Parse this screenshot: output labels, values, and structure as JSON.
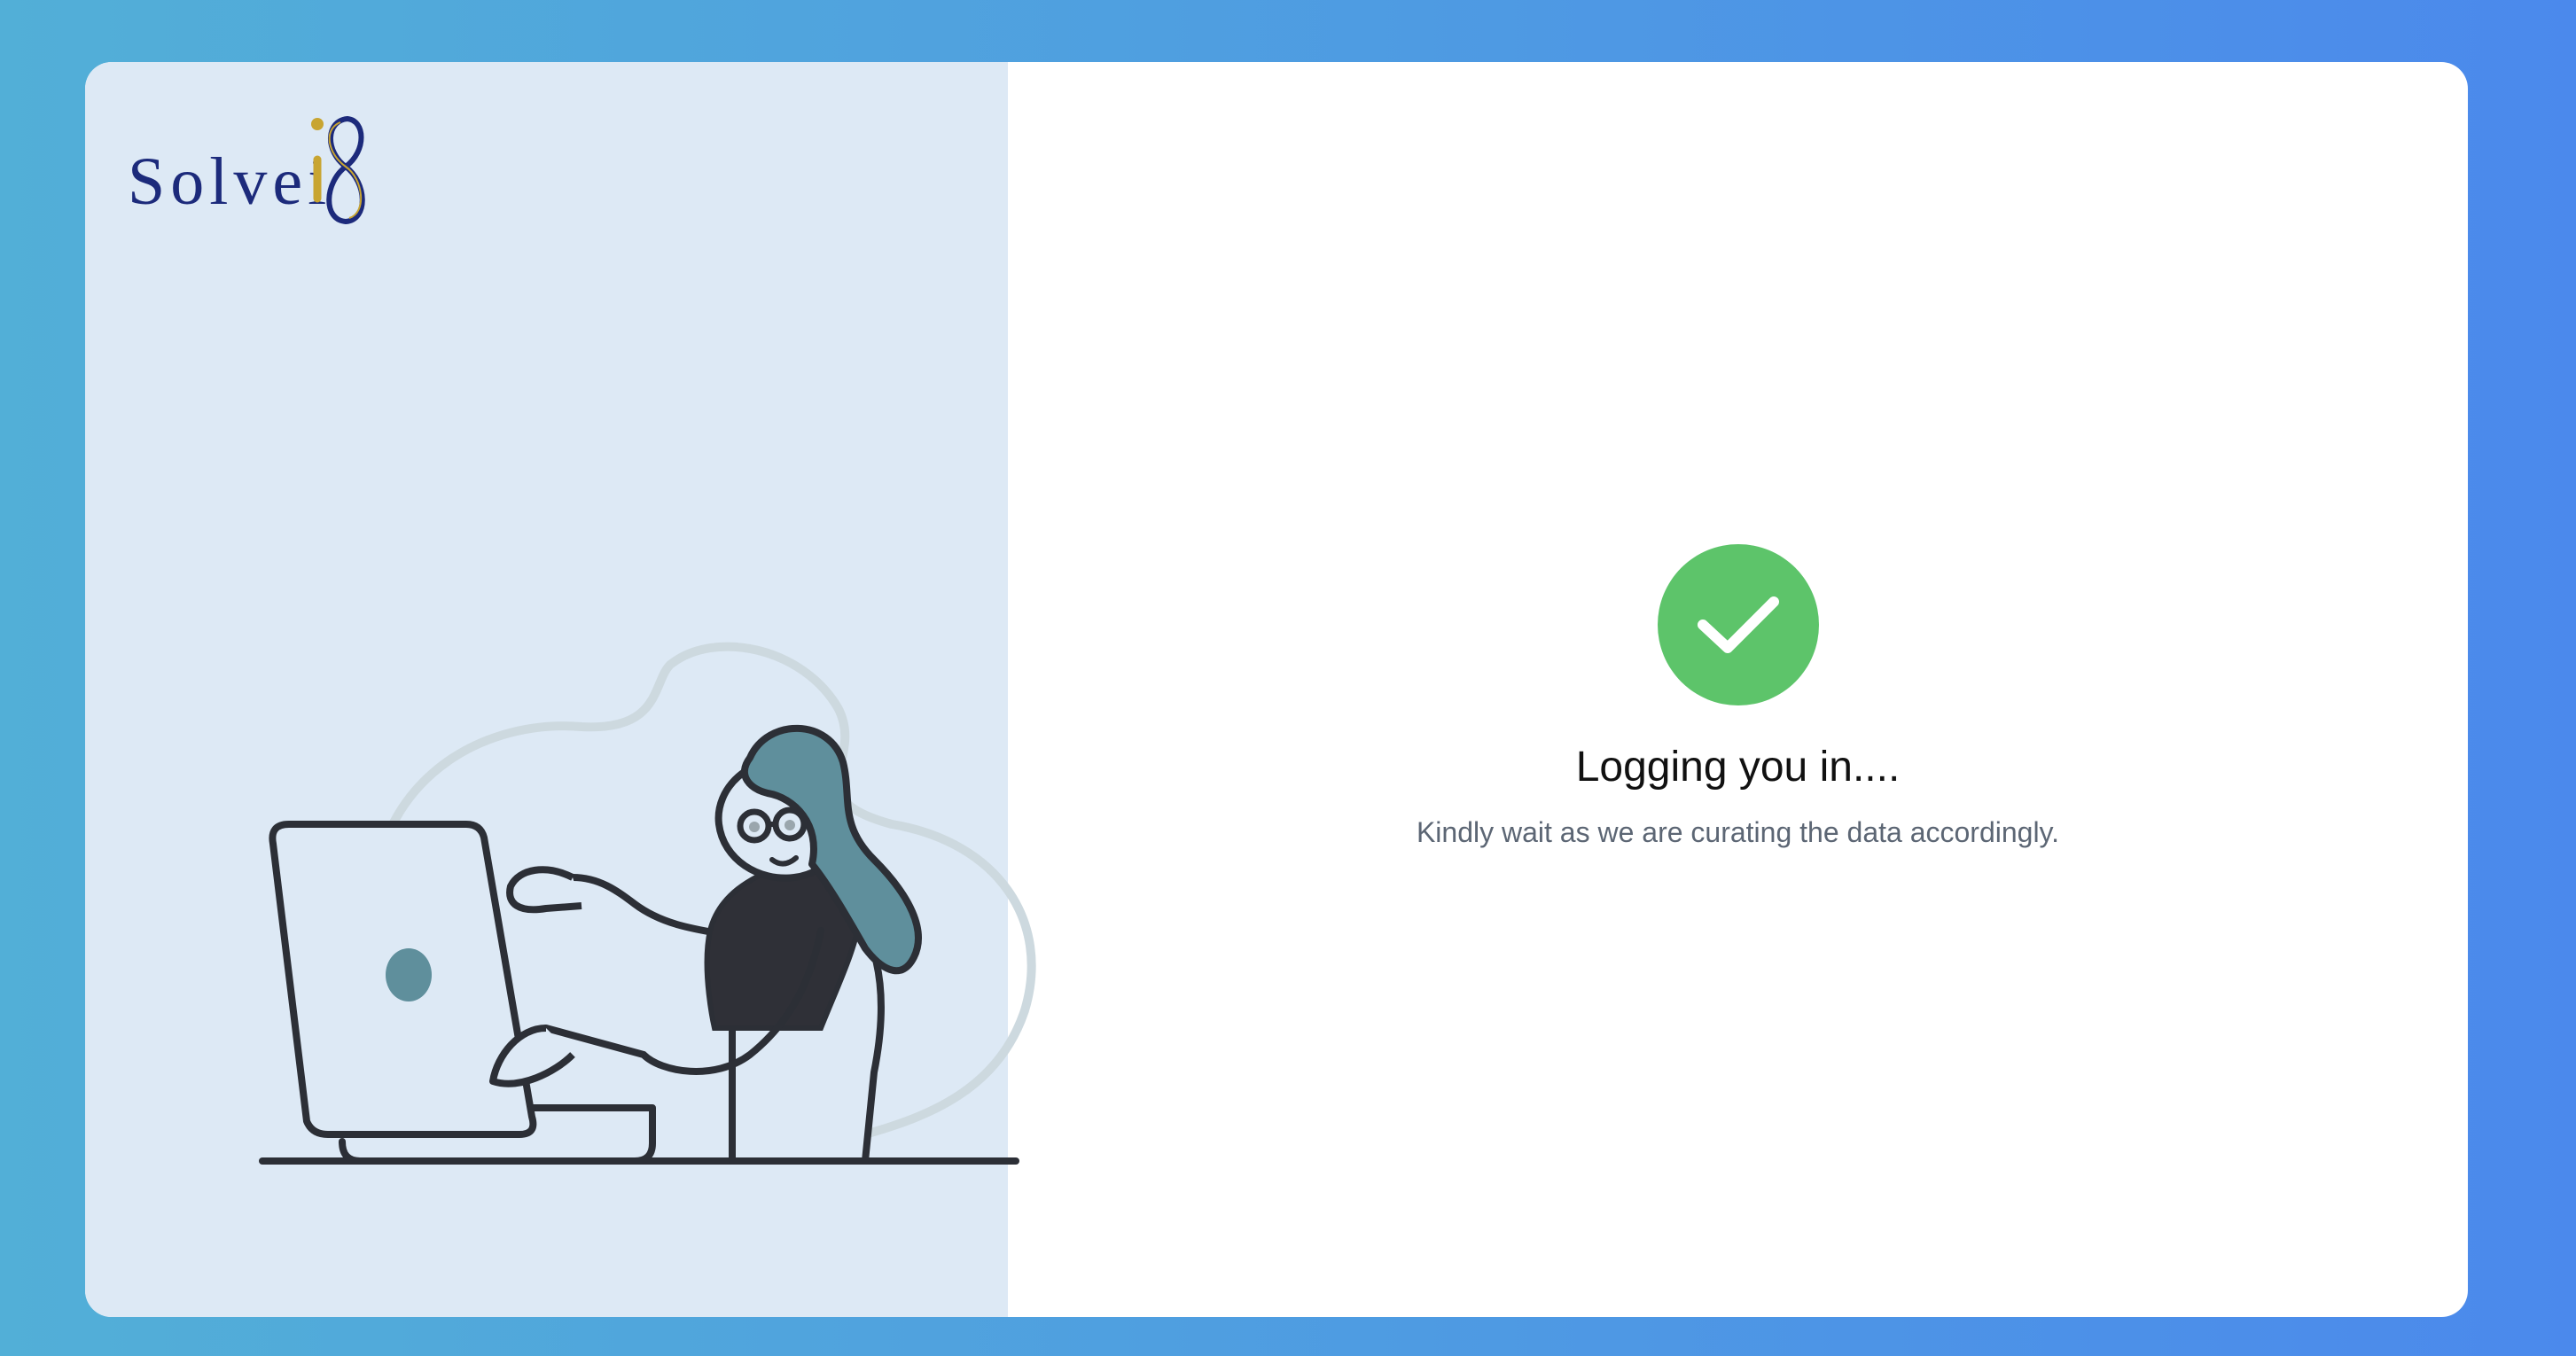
{
  "brand": {
    "logo_text": "Solvei",
    "logo_mark_icon": "infinity-eight-icon",
    "colors": {
      "navy": "#1c2a7b",
      "gold": "#c8a531",
      "green": "#5dc46a"
    }
  },
  "status": {
    "icon": "check-circle-icon",
    "title": "Logging you in....",
    "message": "Kindly wait as we are curating the data accordingly."
  },
  "illustration": {
    "icon": "person-using-laptop-illustration"
  },
  "theme": {
    "background_gradient_start": "#52afd7",
    "background_gradient_end": "#4b89ec",
    "left_panel_bg": "#dde9f5",
    "card_bg": "#ffffff"
  }
}
